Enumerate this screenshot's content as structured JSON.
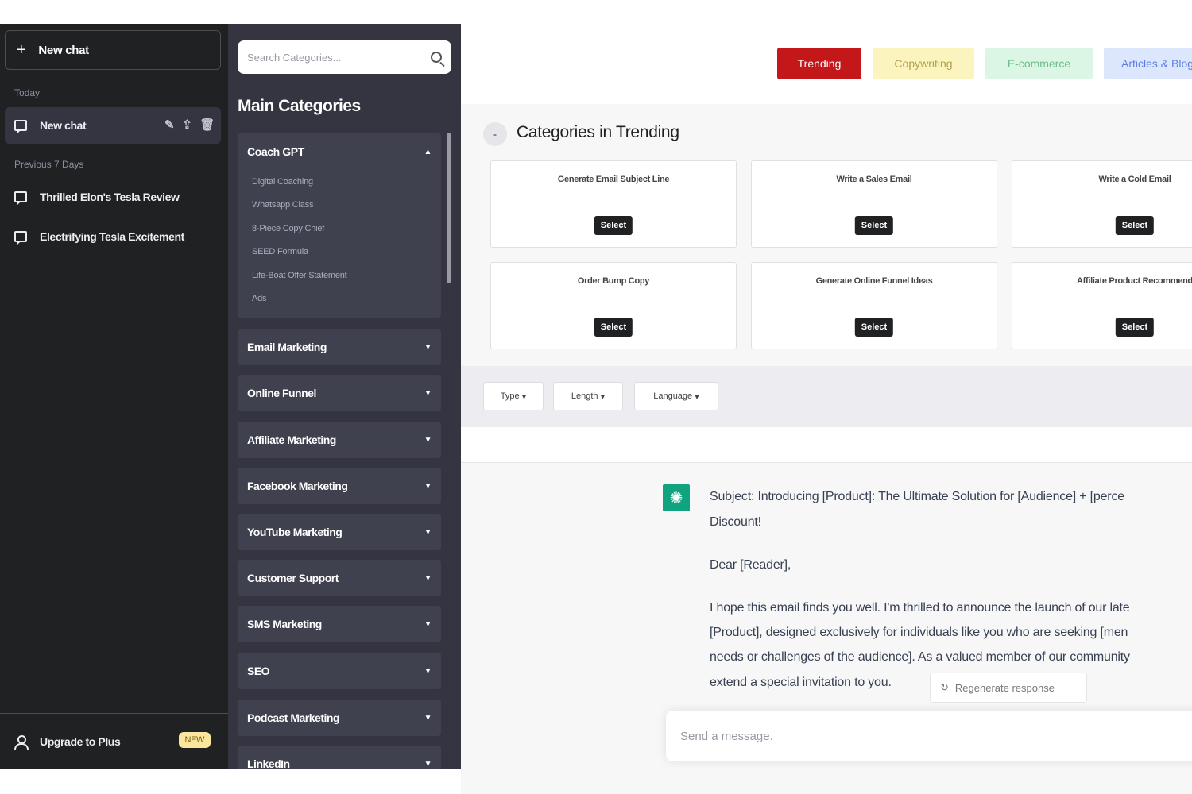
{
  "sidebar": {
    "new_chat": "New chat",
    "today_label": "Today",
    "active_chat": "New chat",
    "prev_label": "Previous 7 Days",
    "history": [
      "Thrilled Elon's Tesla Review",
      "Electrifying Tesla Excitement"
    ],
    "upgrade": "Upgrade to Plus",
    "new_badge": "NEW"
  },
  "categories": {
    "search_placeholder": "Search Categories...",
    "title": "Main Categories",
    "expanded": {
      "label": "Coach GPT",
      "items": [
        "Digital Coaching",
        "Whatsapp Class",
        "8-Piece Copy Chief",
        "SEED Formula",
        "Life-Boat Offer Statement",
        "Ads"
      ]
    },
    "rows": [
      "Email Marketing",
      "Online Funnel",
      "Affiliate Marketing",
      "Facebook Marketing",
      "YouTube Marketing",
      "Customer Support",
      "SMS Marketing",
      "SEO",
      "Podcast Marketing",
      "LinkedIn"
    ]
  },
  "main": {
    "tabs": [
      "Trending",
      "Copywriting",
      "E-commerce",
      "Articles & Blogs"
    ],
    "section_title": "Categories in Trending",
    "collapse_symbol": "-",
    "cards": [
      {
        "title": "Generate Email Subject Line",
        "button": "Select"
      },
      {
        "title": "Write a Sales Email",
        "button": "Select"
      },
      {
        "title": "Write a Cold Email",
        "button": "Select"
      },
      {
        "title": "Order Bump Copy",
        "button": "Select"
      },
      {
        "title": "Generate Online Funnel Ideas",
        "button": "Select"
      },
      {
        "title": "Affiliate Product Recommend",
        "button": "Select"
      }
    ],
    "filters": [
      "Type",
      "Length",
      "Language"
    ],
    "message": {
      "line1": "Subject: Introducing [Product]: The Ultimate Solution for [Audience] + [perce",
      "line2": "Discount!",
      "line3": "Dear [Reader],",
      "line4": "I hope this email finds you well. I'm thrilled to announce the launch of our late",
      "line5": "[Product], designed exclusively for individuals like you who are seeking [men",
      "line6": "needs or challenges of the audience]. As a valued member of our community",
      "line7": "extend a special invitation to you."
    },
    "regenerate": "Regenerate response",
    "input_placeholder": "Send a message."
  },
  "colors": {
    "sidebar_bg": "#202123",
    "panel_bg": "#343541",
    "trending_tab": "#c4171a",
    "bot_avatar": "#10a37f"
  }
}
